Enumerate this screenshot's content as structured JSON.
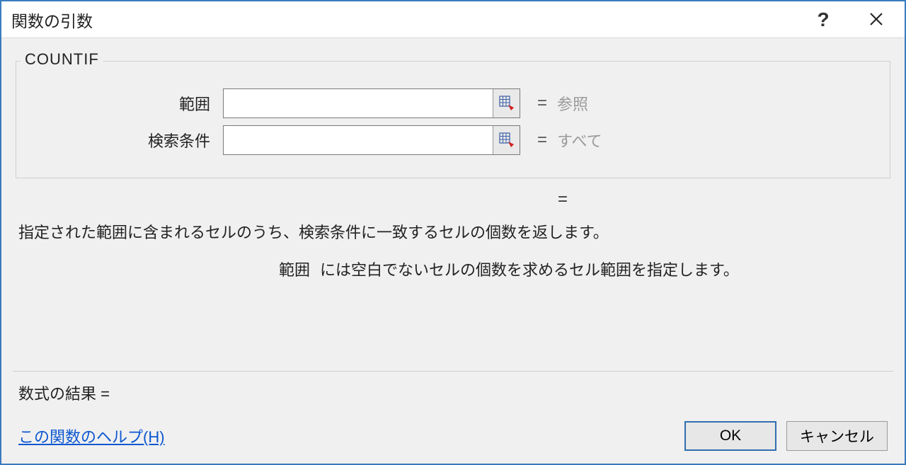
{
  "titlebar": {
    "title": "関数の引数"
  },
  "group": {
    "legend": "COUNTIF",
    "fields": {
      "range": {
        "label": "範囲",
        "value": "",
        "hint": "参照"
      },
      "criteria": {
        "label": "検索条件",
        "value": "",
        "hint": "すべて"
      }
    }
  },
  "equals_symbol": "=",
  "result_preview": "=",
  "description": "指定された範囲に含まれるセルのうち、検索条件に一致するセルの個数を返します。",
  "arg_help": {
    "name": "範囲",
    "text": "には空白でないセルの個数を求めるセル範囲を指定します。"
  },
  "formula_result": {
    "label": "数式の結果 =",
    "value": ""
  },
  "help_link": "この関数のヘルプ(H)",
  "buttons": {
    "ok": "OK",
    "cancel": "キャンセル"
  }
}
